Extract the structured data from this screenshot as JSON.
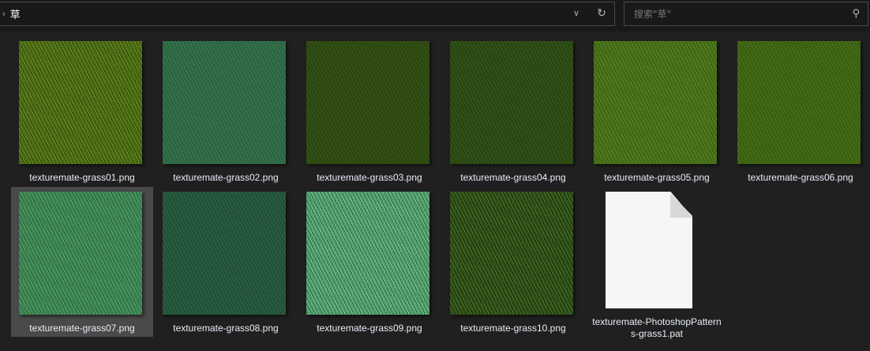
{
  "address": {
    "path": "草"
  },
  "search": {
    "placeholder": "搜索\"草\""
  },
  "files": [
    {
      "name": "texturemate-grass01.png",
      "c1": "#4a6a14",
      "c2": "#2e4a0c",
      "c3": "#6a8a20"
    },
    {
      "name": "texturemate-grass02.png",
      "c1": "#2e6a45",
      "c2": "#25573a",
      "c3": "#3c7a52"
    },
    {
      "name": "texturemate-grass03.png",
      "c1": "#2e4a12",
      "c2": "#243c0e",
      "c3": "#3a5818"
    },
    {
      "name": "texturemate-grass04.png",
      "c1": "#2c4a14",
      "c2": "#1f3a0e",
      "c3": "#3a5a1c"
    },
    {
      "name": "texturemate-grass05.png",
      "c1": "#466e18",
      "c2": "#355a10",
      "c3": "#5a8424"
    },
    {
      "name": "texturemate-grass06.png",
      "c1": "#3e6414",
      "c2": "#30520e",
      "c3": "#4a7418"
    },
    {
      "name": "texturemate-grass07.png",
      "c1": "#3a8050",
      "c2": "#2a6a3e",
      "c3": "#56a06a",
      "selected": true
    },
    {
      "name": "texturemate-grass08.png",
      "c1": "#24553a",
      "c2": "#1a4430",
      "c3": "#2e6646"
    },
    {
      "name": "texturemate-grass09.png",
      "c1": "#4a9a66",
      "c2": "#2e6e48",
      "c3": "#7cc092"
    },
    {
      "name": "texturemate-grass10.png",
      "c1": "#2c4a16",
      "c2": "#1c3210",
      "c3": "#4a7224"
    },
    {
      "name": "texturemate-PhotoshopPatterns-grass1.pat",
      "generic": true
    }
  ]
}
